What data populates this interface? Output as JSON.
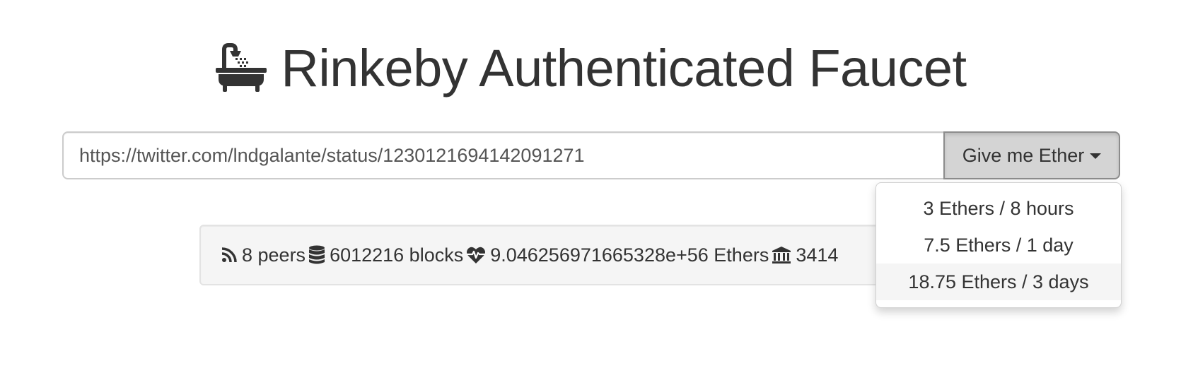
{
  "header": {
    "title": "Rinkeby Authenticated Faucet",
    "icon": "bath-icon"
  },
  "request": {
    "url_value": "https://twitter.com/lndgalante/status/1230121694142091271",
    "button_label": "Give me Ether"
  },
  "dropdown": {
    "options": [
      "3 Ethers / 8 hours",
      "7.5 Ethers / 1 day",
      "18.75 Ethers / 3 days"
    ],
    "highlighted_index": 2
  },
  "stats": {
    "peers": "8 peers",
    "blocks": "6012216 blocks",
    "funds": "9.046256971665328e+56 Ethers",
    "funded": "3414"
  },
  "colors": {
    "text": "#333333",
    "button_active_bg": "#d4d4d4",
    "well_bg": "#f5f5f5",
    "highlight_bg": "#f5f5f5"
  }
}
